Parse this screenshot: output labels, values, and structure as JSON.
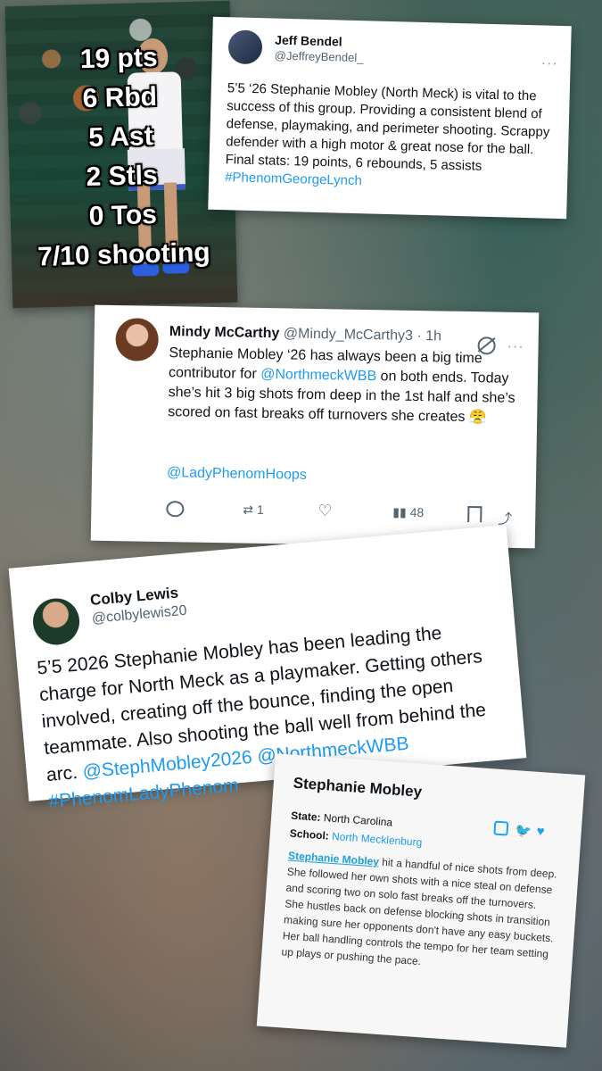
{
  "photo": {
    "stats": [
      "19 pts",
      "6 Rbd",
      "5 Ast",
      "2 Stls",
      "0 Tos",
      "7/10 shooting"
    ]
  },
  "tweet1": {
    "name": "Jeff Bendel",
    "handle": "@JeffreyBendel_",
    "text": "5’5 ‘26 Stephanie Mobley (North Meck) is vital to the success of this group. Providing a consistent blend of defense, playmaking, and perimeter shooting. Scrappy defender with a high motor & great nose for the ball. Final stats: 19 points, 6 rebounds, 5 assists ",
    "hashtag": "#PhenomGeorgeLynch"
  },
  "tweet2": {
    "name": "Mindy McCarthy",
    "handle_time": "@Mindy_McCarthy3 · 1h",
    "text_a": "Stephanie Mobley ‘26 has always been a big time contributor for ",
    "mention_inline": "@NorthmeckWBB",
    "text_b": " on both ends. Today she’s hit 3 big shots from deep in the 1st half and she’s scored on fast breaks off turnovers she creates 😤",
    "mention": "@LadyPhenomHoops",
    "retweets": "1",
    "views": "48"
  },
  "tweet3": {
    "name": "Colby Lewis",
    "handle": "@colbylewis20",
    "text": "5’5 2026 Stephanie Mobley has been leading the charge for North Meck as a playmaker. Getting others involved, creating off the bounce, finding the open teammate. Also shooting the ball well from behind the arc. ",
    "links": "@StephMobley2026 @NorthmeckWBB #PhenomLadyPhenom"
  },
  "profile": {
    "title": "Stephanie Mobley",
    "state_label": "State:",
    "state": "North Carolina",
    "school_label": "School:",
    "school": "North Mecklenburg",
    "name_link": "Stephanie Mobley",
    "text": " hit a handful of nice shots from deep.  She followed her own shots with a nice steal on defense and scoring two on solo fast breaks off the turnovers.  She hustles back on defense blocking shots in transition making sure her opponents don't have any easy buckets.  Her ball handling controls the tempo for her team setting up plays or pushing the pace."
  },
  "colors": {
    "link": "#1d9bf0",
    "profile_link": "#1aa0d8"
  }
}
